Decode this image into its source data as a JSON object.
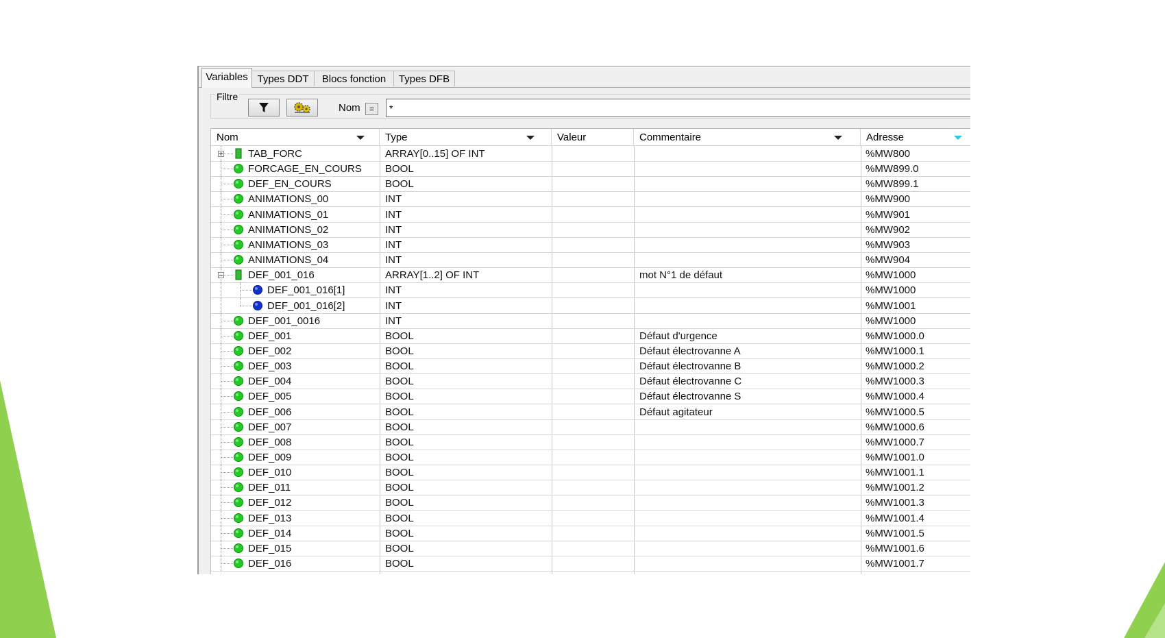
{
  "tabs": [
    "Variables",
    "Types DDT",
    "Blocs fonction",
    "Types DFB"
  ],
  "filter": {
    "legend": "Filtre",
    "name_label": "Nom",
    "eq_label": "=",
    "value": "*"
  },
  "columns": {
    "nom": "Nom",
    "type": "Type",
    "valeur": "Valeur",
    "commentaire": "Commentaire",
    "adresse": "Adresse"
  },
  "rows": [
    {
      "name": "TAB_FORC",
      "type": "ARRAY[0..15] OF INT",
      "comment": "",
      "address": "%MW800",
      "kind": "array",
      "level": 0,
      "expand": "plus"
    },
    {
      "name": "FORCAGE_EN_COURS",
      "type": "BOOL",
      "comment": "",
      "address": "%MW899.0",
      "kind": "var",
      "level": 0
    },
    {
      "name": "DEF_EN_COURS",
      "type": "BOOL",
      "comment": "",
      "address": "%MW899.1",
      "kind": "var",
      "level": 0
    },
    {
      "name": "ANIMATIONS_00",
      "type": "INT",
      "comment": "",
      "address": "%MW900",
      "kind": "var",
      "level": 0
    },
    {
      "name": "ANIMATIONS_01",
      "type": "INT",
      "comment": "",
      "address": "%MW901",
      "kind": "var",
      "level": 0
    },
    {
      "name": "ANIMATIONS_02",
      "type": "INT",
      "comment": "",
      "address": "%MW902",
      "kind": "var",
      "level": 0
    },
    {
      "name": "ANIMATIONS_03",
      "type": "INT",
      "comment": "",
      "address": "%MW903",
      "kind": "var",
      "level": 0
    },
    {
      "name": "ANIMATIONS_04",
      "type": "INT",
      "comment": "",
      "address": "%MW904",
      "kind": "var",
      "level": 0
    },
    {
      "name": "DEF_001_016",
      "type": "ARRAY[1..2] OF INT",
      "comment": "mot N°1 de défaut",
      "address": "%MW1000",
      "kind": "array",
      "level": 0,
      "expand": "minus"
    },
    {
      "name": "DEF_001_016[1]",
      "type": "INT",
      "comment": "",
      "address": "%MW1000",
      "kind": "element",
      "level": 1
    },
    {
      "name": "DEF_001_016[2]",
      "type": "INT",
      "comment": "",
      "address": "%MW1001",
      "kind": "element",
      "level": 1
    },
    {
      "name": "DEF_001_0016",
      "type": "INT",
      "comment": "",
      "address": "%MW1000",
      "kind": "var",
      "level": 0
    },
    {
      "name": "DEF_001",
      "type": "BOOL",
      "comment": "Défaut d'urgence",
      "address": "%MW1000.0",
      "kind": "var",
      "level": 0
    },
    {
      "name": "DEF_002",
      "type": "BOOL",
      "comment": "Défaut électrovanne A",
      "address": "%MW1000.1",
      "kind": "var",
      "level": 0
    },
    {
      "name": "DEF_003",
      "type": "BOOL",
      "comment": "Défaut électrovanne B",
      "address": "%MW1000.2",
      "kind": "var",
      "level": 0
    },
    {
      "name": "DEF_004",
      "type": "BOOL",
      "comment": "Défaut électrovanne C",
      "address": "%MW1000.3",
      "kind": "var",
      "level": 0
    },
    {
      "name": "DEF_005",
      "type": "BOOL",
      "comment": "Défaut électrovanne S",
      "address": "%MW1000.4",
      "kind": "var",
      "level": 0
    },
    {
      "name": "DEF_006",
      "type": "BOOL",
      "comment": "Défaut agitateur",
      "address": "%MW1000.5",
      "kind": "var",
      "level": 0
    },
    {
      "name": "DEF_007",
      "type": "BOOL",
      "comment": "",
      "address": "%MW1000.6",
      "kind": "var",
      "level": 0
    },
    {
      "name": "DEF_008",
      "type": "BOOL",
      "comment": "",
      "address": "%MW1000.7",
      "kind": "var",
      "level": 0
    },
    {
      "name": "DEF_009",
      "type": "BOOL",
      "comment": "",
      "address": "%MW1001.0",
      "kind": "var",
      "level": 0
    },
    {
      "name": "DEF_010",
      "type": "BOOL",
      "comment": "",
      "address": "%MW1001.1",
      "kind": "var",
      "level": 0
    },
    {
      "name": "DEF_011",
      "type": "BOOL",
      "comment": "",
      "address": "%MW1001.2",
      "kind": "var",
      "level": 0
    },
    {
      "name": "DEF_012",
      "type": "BOOL",
      "comment": "",
      "address": "%MW1001.3",
      "kind": "var",
      "level": 0
    },
    {
      "name": "DEF_013",
      "type": "BOOL",
      "comment": "",
      "address": "%MW1001.4",
      "kind": "var",
      "level": 0
    },
    {
      "name": "DEF_014",
      "type": "BOOL",
      "comment": "",
      "address": "%MW1001.5",
      "kind": "var",
      "level": 0
    },
    {
      "name": "DEF_015",
      "type": "BOOL",
      "comment": "",
      "address": "%MW1001.6",
      "kind": "var",
      "level": 0
    },
    {
      "name": "DEF_016",
      "type": "BOOL",
      "comment": "",
      "address": "%MW1001.7",
      "kind": "var",
      "level": 0
    }
  ],
  "colors": {
    "slide_triangle": "#8fd14f",
    "slide_triangle_light": "#b5e38a",
    "var_icon": "#22cc22",
    "element_icon": "#1133cc",
    "array_icon": "#33bb33"
  },
  "icons": {
    "var": "green-circle-icon",
    "element": "blue-circle-icon",
    "array": "green-array-icon",
    "filter_button": "funnel-icon",
    "variables_button": "gear-variables-icon"
  }
}
